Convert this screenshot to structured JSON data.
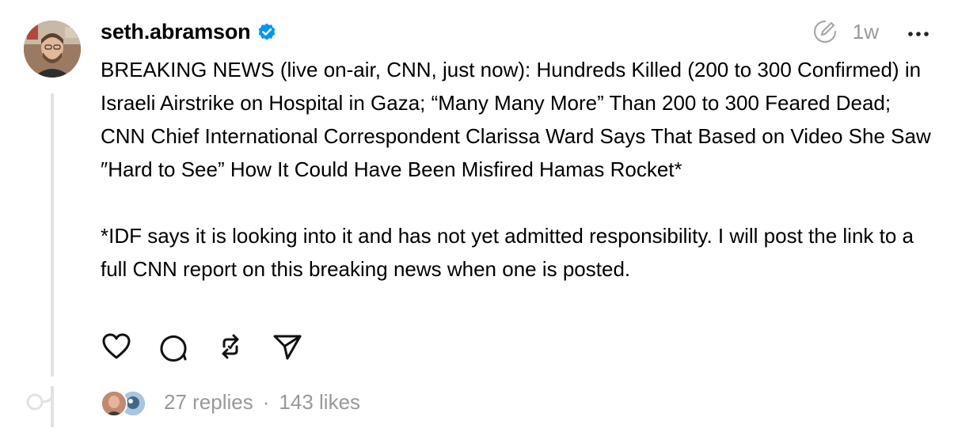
{
  "post": {
    "username": "seth.abramson",
    "verified": true,
    "timestamp": "1w",
    "paragraphs": [
      "BREAKING NEWS (live on-air, CNN, just now): Hundreds Killed (200 to 300 Confirmed) in Israeli Airstrike on Hospital in Gaza; “Many Many More” Than 200 to 300 Feared Dead; CNN Chief International Correspondent Clarissa Ward Says That Based on Video She Saw ″Hard to See” How It Could Have Been Misfired Hamas Rocket*",
      "*IDF says it is looking into it and has not yet admitted responsibility. I will post the link to a full CNN report on this breaking news when one is posted."
    ],
    "replies": "27 replies",
    "separator": "·",
    "likes": "143 likes"
  },
  "icons": {
    "verified": "verified-badge-icon",
    "edited": "edited-icon",
    "more": "more-icon",
    "like": "heart-icon",
    "reply": "comment-icon",
    "repost": "repost-icon",
    "share": "send-icon"
  },
  "colors": {
    "verified": "#0095f6",
    "muted": "#999999",
    "thread": "#e2e2e2"
  }
}
